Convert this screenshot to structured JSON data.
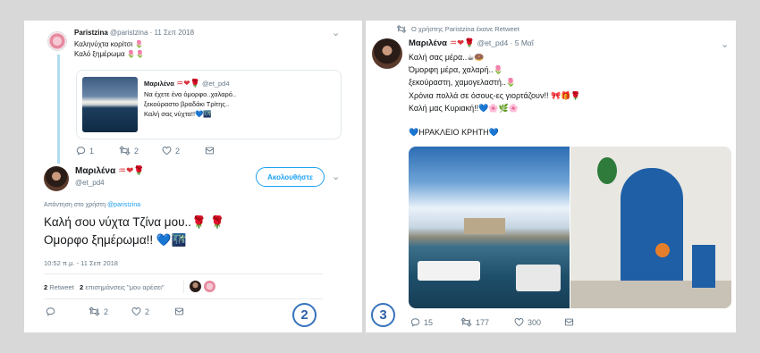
{
  "left": {
    "parent": {
      "name": "Paristzina",
      "meta": "@paristzina · 11 Σεπ 2018",
      "line1": "Καληνύχτα κορίτσι 🌷",
      "line2": "Καλό ξημέρωμα 🌷🌷"
    },
    "quoted": {
      "name": "Μαριλένα",
      "handle": "@et_pd4",
      "line1": "Να έχετε ένα όμορφο..χαλαρό..",
      "line2": "ξεκούραστο βραδάκι Τρίτης..",
      "line3": "Καλή σας νύχτα!!💙🌃"
    },
    "parent_actions": {
      "replies": "1",
      "retweets": "2",
      "likes": "2"
    },
    "reply": {
      "name": "Μαριλένα",
      "handle": "@et_pd4",
      "follow_label": "Ακολουθήστε",
      "replying_prefix": "Απάντηση στο χρήστη",
      "replying_to": "@paristzina",
      "text_line1": "Καλή σου νύχτα Τζίνα μου..🌹 🌹",
      "text_line2": "Ομορφο ξημέρωμα!! 💙🌃",
      "timestamp": "10:52 π.μ. - 11 Σεπ 2018",
      "retweet_count": "2",
      "retweet_label": "Retweet",
      "likes_count": "2",
      "likes_label": "επισημάνσεις \"μου αρέσει\"",
      "actions": {
        "retweets": "2",
        "likes": "2"
      }
    },
    "badge": "2"
  },
  "right": {
    "retweet_note": "Ο χρήστης Paristzina έκανε Retweet",
    "name": "Μαριλένα",
    "meta": "@et_pd4 · 5 Μαΐ",
    "lines": [
      "Καλή σας μέρα..☕🍩",
      "Όμορφη μέρα, χαλαρή..🌷",
      "ξεκούραστη, χαμογελαστή..🌷",
      "Χρόνια πολλά σε όσους-ες γιορτάζουν!! 🎀🎁🌹",
      "Καλή μας Κυριακή!!💙🌸🌿🌸"
    ],
    "location": "💙ΗΡΑΚΛΕΙΟ ΚΡΗΤΗ💙",
    "actions": {
      "replies": "15",
      "retweets": "177",
      "likes": "300"
    },
    "badge": "3"
  },
  "colors": {
    "link": "#1da1f2",
    "thread_line": "#b0dcf0",
    "badge": "#3673bd",
    "heart": "#e0245e"
  },
  "icons": [
    "reply-icon",
    "retweet-icon",
    "heart-icon",
    "dm-icon",
    "chevron-down-icon"
  ]
}
